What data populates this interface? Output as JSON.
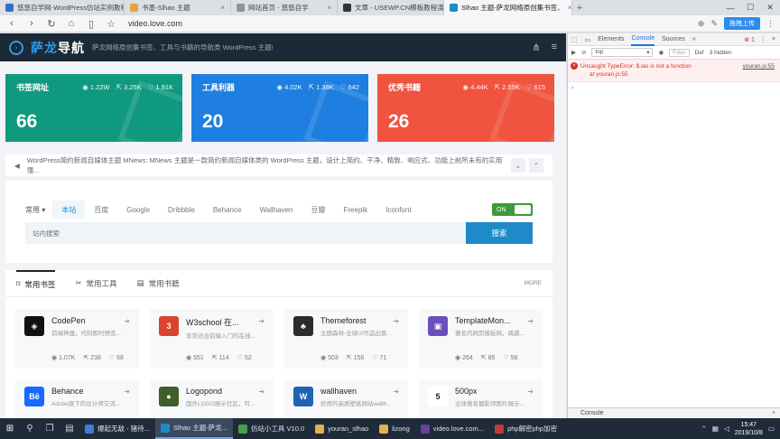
{
  "browser": {
    "tabs": [
      {
        "label": "悠悠自学网-WordPress仿站实例教程",
        "color": "#2f6fce"
      },
      {
        "label": "书墨-Slhao 主题",
        "color": "#e6a23c"
      },
      {
        "label": "网站首页 - 悠悠自学",
        "color": "#909399"
      },
      {
        "label": "文章 - USEWP.CN模板教程演示网站",
        "color": "#333333"
      },
      {
        "label": "Slhao 主题-萨龙网络原创集书签、",
        "color": "#1e8bc8",
        "active": true
      }
    ],
    "url": "video.love.com",
    "upload_label": "拖拽上传"
  },
  "site": {
    "logo": {
      "main": "萨龙",
      "accent": "导航"
    },
    "tagline": "萨龙网络原创集书签、工具与书籍的导航类 WordPress 主题!",
    "stats": [
      {
        "title": "书签网址",
        "views": "1.22W",
        "shares": "3.25K",
        "likes": "1.91K",
        "value": "66",
        "color": "#0f9a7f"
      },
      {
        "title": "工具利器",
        "views": "4.02K",
        "shares": "1.38K",
        "likes": "642",
        "value": "20",
        "color": "#1e7fe0"
      },
      {
        "title": "优秀书籍",
        "views": "4.44K",
        "shares": "2.55K",
        "likes": "615",
        "value": "26",
        "color": "#f0533f"
      }
    ],
    "notice": "WordPress简约新闻自媒体主题 MNews: MNews 主题是一款简约新闻自媒体类的 WordPress 主题，设计上简约、干净、精致、响应式、功能上前所未有的实用强...",
    "search": {
      "group_label": "常用",
      "engines": [
        "本站",
        "百度",
        "Google",
        "Dribbble",
        "Behance",
        "Wallhaven",
        "豆瓣",
        "Freepik",
        "Iconfont"
      ],
      "toggle_label": "ON",
      "placeholder": "站内搜索",
      "button_label": "搜索"
    },
    "bookmarks": {
      "tabs": [
        "常用书签",
        "常用工具",
        "常用书籍"
      ],
      "more_label": "MORE",
      "cards": [
        {
          "name": "CodePen",
          "desc": "前端神器，代码即时预览...",
          "views": "1.07K",
          "shares": "238",
          "likes": "68",
          "icon_char": "◈",
          "icon_bg": "#111111"
        },
        {
          "name": "W3school 在...",
          "desc": "非常适合前端入门的在线...",
          "views": "551",
          "shares": "114",
          "likes": "52",
          "icon_char": "3",
          "icon_bg": "#d9432f"
        },
        {
          "name": "Themeforest",
          "desc": "主题森林-全球UI作品出售...",
          "views": "503",
          "shares": "156",
          "likes": "71",
          "icon_char": "♣",
          "icon_bg": "#2b2b2b"
        },
        {
          "name": "TemplateMon...",
          "desc": "著名的网页模板网，偶遇...",
          "views": "264",
          "shares": "85",
          "likes": "58",
          "icon_char": "▣",
          "icon_bg": "#6b4fbb"
        },
        {
          "name": "Behance",
          "desc": "Adobe旗下的设计师交流...",
          "views": "",
          "shares": "",
          "likes": "",
          "icon_char": "Bē",
          "icon_bg": "#1769ff"
        },
        {
          "name": "Logopond",
          "desc": "国外LOGO展示社区，可...",
          "views": "",
          "shares": "",
          "likes": "",
          "icon_char": "●",
          "icon_bg": "#3f5e2a"
        },
        {
          "name": "wallhaven",
          "desc": "好用的高质壁纸网站wallh...",
          "views": "",
          "shares": "",
          "likes": "",
          "icon_char": "W",
          "icon_bg": "#1f63b5"
        },
        {
          "name": "500px",
          "desc": "全球著名摄影师图片展示...",
          "views": "",
          "shares": "",
          "likes": "",
          "icon_char": "5",
          "icon_bg": "#ffffff"
        }
      ]
    }
  },
  "devtools": {
    "tabs": [
      "Elements",
      "Console",
      "Sources"
    ],
    "more": "»",
    "error_count": "1",
    "context": "top",
    "filter_placeholder": "Filter",
    "levels": "Def",
    "hidden": "3 hidden",
    "error_text": "Uncaught TypeError: $.ias is not a function",
    "error_at": "at youran.js:55",
    "error_source": "youran.js:55",
    "drawer_label": "Console"
  },
  "taskbar": {
    "apps": [
      {
        "label": "爆起无敌 - 猪待...",
        "color": "#3b7fd6"
      },
      {
        "label": "Slhao 主题-萨龙...",
        "color": "#1e8bc8",
        "active": true
      },
      {
        "label": "仿站小工具 V10.0",
        "color": "#4aa04a"
      },
      {
        "label": "youran_slhao",
        "color": "#e0b44c"
      },
      {
        "label": "lizong",
        "color": "#e0b44c"
      },
      {
        "label": "video.love.com...",
        "color": "#6a3fa0"
      },
      {
        "label": "php解密php加密",
        "color": "#c33a3a"
      }
    ],
    "time": "15:47",
    "date": "2019/10/8"
  }
}
